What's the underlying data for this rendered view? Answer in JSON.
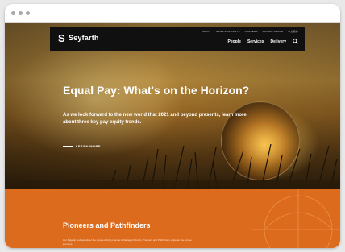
{
  "site": {
    "logo_text": "Seyfarth",
    "logo_mark": "S"
  },
  "utility_nav": [
    "About",
    "News & Insights",
    "Careers",
    "Global Reach",
    "中文简体"
  ],
  "main_nav": [
    "People",
    "Services",
    "Delivery"
  ],
  "hero": {
    "title": "Equal Pay: What's on the Horizon?",
    "subtitle": "As we look forward to the new world that 2021 and beyond presents, learn more about three key pay equity trends.",
    "cta": "LEARN MORE"
  },
  "section": {
    "title": "Pioneers and Pathfinders",
    "body": "Our flagship podcast about the people driving change in the legal industry. Pioneers and Pathfinders explores the unique journeys"
  },
  "colors": {
    "navbar": "#101010",
    "accent_orange": "#dc6b1e"
  },
  "icons": {
    "search": "search-icon",
    "window_controls": [
      "window-dot-icon",
      "window-dot-icon",
      "window-dot-icon"
    ]
  }
}
